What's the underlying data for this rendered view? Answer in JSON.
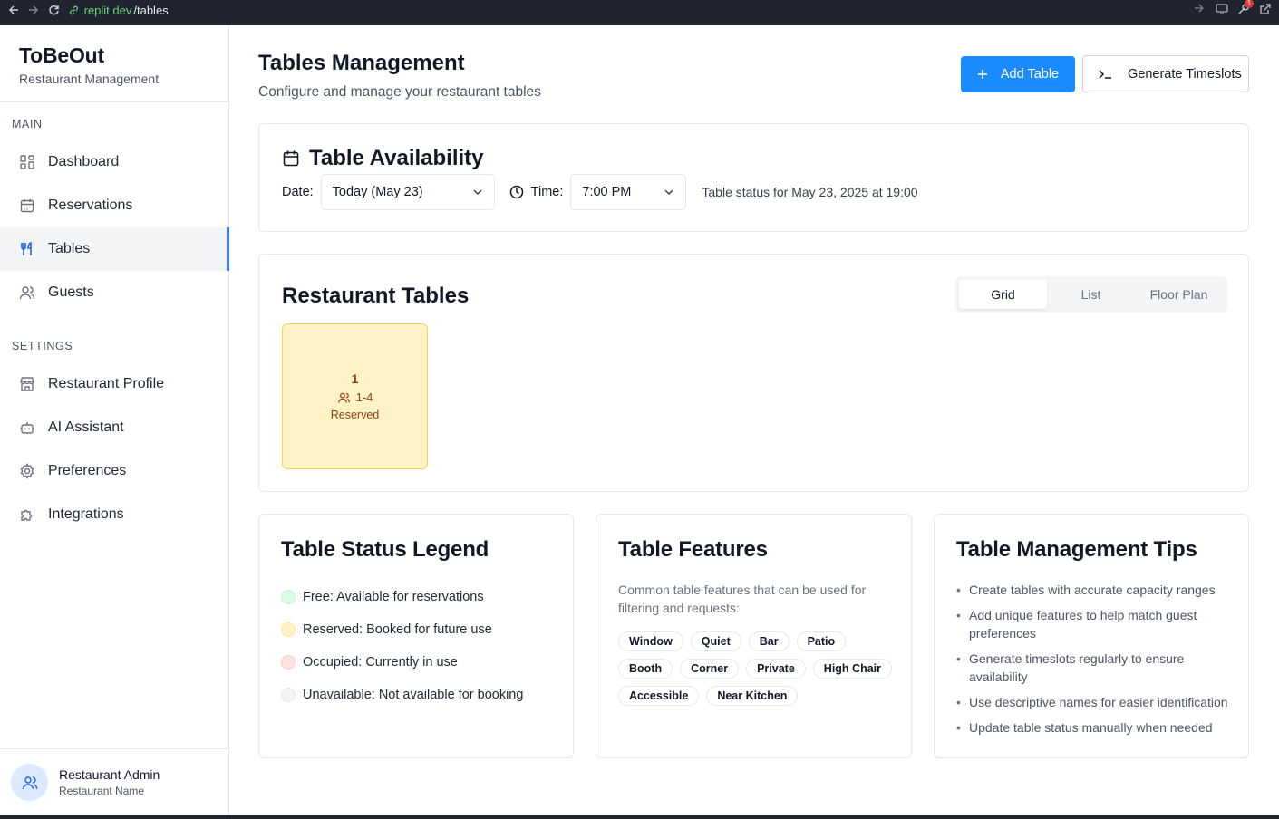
{
  "browser": {
    "url_host": ".replit.dev",
    "url_path": "/tables",
    "notification_count": "1"
  },
  "sidebar": {
    "brand": "ToBeOut",
    "brand_sub": "Restaurant Management",
    "main_title": "MAIN",
    "main_items": [
      {
        "label": "Dashboard",
        "icon": "grid-icon"
      },
      {
        "label": "Reservations",
        "icon": "calendar-icon"
      },
      {
        "label": "Tables",
        "icon": "utensils-icon",
        "active": true
      },
      {
        "label": "Guests",
        "icon": "users-icon"
      }
    ],
    "settings_title": "SETTINGS",
    "settings_items": [
      {
        "label": "Restaurant Profile",
        "icon": "store-icon"
      },
      {
        "label": "AI Assistant",
        "icon": "bot-icon"
      },
      {
        "label": "Preferences",
        "icon": "gear-icon"
      },
      {
        "label": "Integrations",
        "icon": "puzzle-icon"
      }
    ],
    "user": {
      "name": "Restaurant Admin",
      "role": "Restaurant Name"
    }
  },
  "header": {
    "title": "Tables Management",
    "subtitle": "Configure and manage your restaurant tables",
    "add_table": "Add Table",
    "generate_timeslots": "Generate Timeslots"
  },
  "availability": {
    "title": "Table Availability",
    "date_label": "Date:",
    "date_value": "Today (May 23)",
    "time_label": "Time:",
    "time_value": "7:00 PM",
    "status_text": "Table status for May 23, 2025 at 19:00"
  },
  "restaurant_tables": {
    "title": "Restaurant Tables",
    "views": [
      "Grid",
      "List",
      "Floor Plan"
    ],
    "selected_view": "Grid",
    "tables": [
      {
        "number": "1",
        "capacity": "1-4",
        "status": "Reserved"
      }
    ]
  },
  "legend": {
    "title": "Table Status Legend",
    "items": [
      {
        "label": "Free: Available for reservations",
        "fill": "#dcfce7",
        "border": "#bbf7d0"
      },
      {
        "label": "Reserved: Booked for future use",
        "fill": "#fef3c7",
        "border": "#fde68a"
      },
      {
        "label": "Occupied: Currently in use",
        "fill": "#fee2e2",
        "border": "#fecaca"
      },
      {
        "label": "Unavailable: Not available for booking",
        "fill": "#f3f4f6",
        "border": "#e5e7eb"
      }
    ]
  },
  "features": {
    "title": "Table Features",
    "description": "Common table features that can be used for filtering and requests:",
    "chips": [
      "Window",
      "Quiet",
      "Bar",
      "Patio",
      "Booth",
      "Corner",
      "Private",
      "High Chair",
      "Accessible",
      "Near Kitchen"
    ]
  },
  "tips": {
    "title": "Table Management Tips",
    "items": [
      "Create tables with accurate capacity ranges",
      "Add unique features to help match guest preferences",
      "Generate timeslots regularly to ensure availability",
      "Use descriptive names for easier identification",
      "Update table status manually when needed"
    ]
  },
  "colors": {
    "accent": "#1a8cff",
    "reserved_bg": "#fef3c7",
    "reserved_text": "#92400e"
  }
}
